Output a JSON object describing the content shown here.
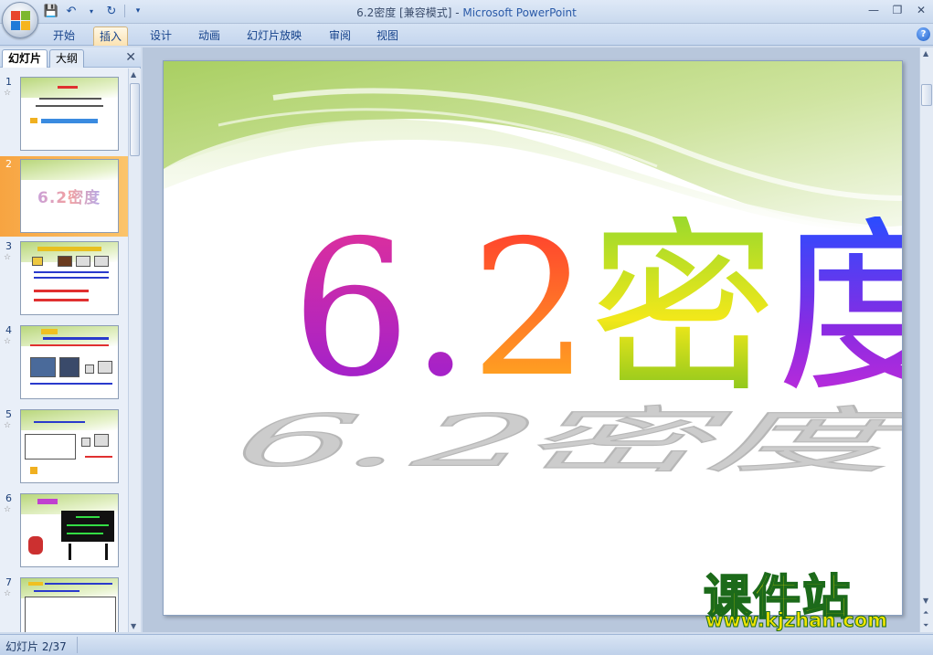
{
  "window": {
    "title": "6.2密度 [兼容模式]",
    "title_sep": " - ",
    "app_name": "Microsoft PowerPoint"
  },
  "quick_access": [
    "save-icon",
    "undo-icon",
    "redo-icon",
    "customize-icon"
  ],
  "ribbon": {
    "tabs": [
      {
        "label": "开始",
        "active": false
      },
      {
        "label": "插入",
        "active": true
      },
      {
        "label": "设计",
        "active": false
      },
      {
        "label": "动画",
        "active": false
      },
      {
        "label": "幻灯片放映",
        "active": false
      },
      {
        "label": "审阅",
        "active": false
      },
      {
        "label": "视图",
        "active": false
      }
    ],
    "help_label": "?"
  },
  "slide_panel": {
    "tabs": [
      {
        "label": "幻灯片",
        "active": true
      },
      {
        "label": "大纲",
        "active": false
      }
    ],
    "close_label": "✕",
    "slide_numbers": [
      "1",
      "2",
      "3",
      "4",
      "5",
      "6",
      "7"
    ],
    "selected_index": 1,
    "thumb2_title": "6.2密度"
  },
  "slide": {
    "title_chars": [
      "6.",
      "2",
      "密",
      "度"
    ],
    "title_gradients": [
      "linear-gradient(180deg, #e0309a, #9a1fd1)",
      "linear-gradient(180deg, #ff3b2f, #ffb11f)",
      "linear-gradient(180deg, #9ad92c, #f2e81a 55%, #7dc21e)",
      "linear-gradient(180deg, #2a4cff, #8a2be2 60%, #c02bd9)"
    ]
  },
  "watermark": {
    "main": "课件站",
    "url": "www.kjzhan.com"
  },
  "statusbar": {
    "slide_info": "幻灯片 2/37"
  }
}
